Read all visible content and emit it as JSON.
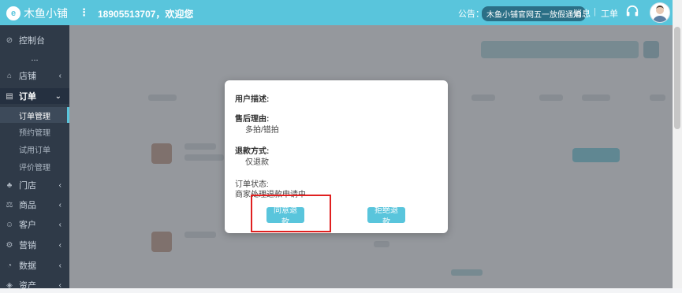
{
  "topbar": {
    "logo_char": "e",
    "app_name": "木鱼小铺",
    "menu_dots": "⋮",
    "welcome": "18905513707，欢迎您",
    "notice_label": "公告：",
    "notice_text": "木鱼小铺官网五一放假通知",
    "message_link": "消息",
    "separator": "|",
    "ticket_link": "工单"
  },
  "sidebar": {
    "dashboard": "控制台",
    "ellipsis": "...",
    "shop": "店铺",
    "order": "订单",
    "order_sub": [
      "订单管理",
      "预约管理",
      "试用订单",
      "评价管理"
    ],
    "store": "门店",
    "goods": "商品",
    "customer": "客户",
    "marketing": "营销",
    "data": "数据",
    "assets": "资产"
  },
  "modal": {
    "user_desc_label": "用户描述:",
    "after_sale_reason_label": "售后理由:",
    "after_sale_reason_value": "多拍/错拍",
    "refund_method_label": "退款方式:",
    "refund_method_value": "仅退款",
    "order_status_label": "订单状态:",
    "order_status_value": "商家处理退款申请中",
    "agree_button": "同意退款",
    "reject_button": "拒绝退款"
  },
  "colors": {
    "accent": "#59c5dc",
    "sidebar_bg": "#2f3a48",
    "highlight": "#e02020"
  }
}
